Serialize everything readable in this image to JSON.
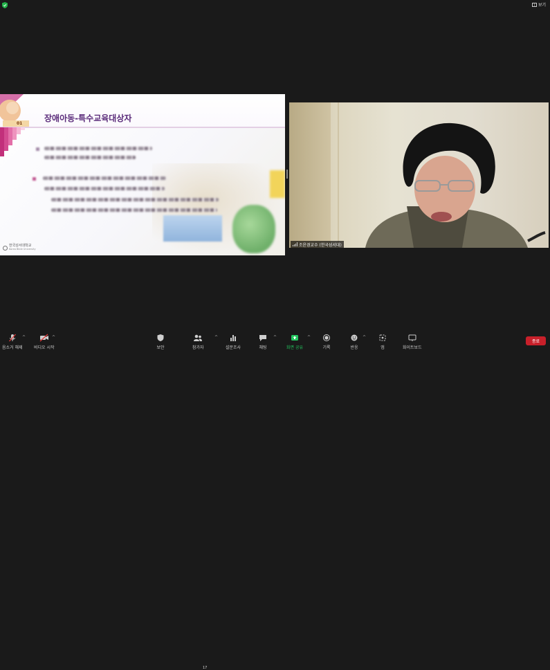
{
  "topbar": {
    "view_label": "보기"
  },
  "slide": {
    "title": "장애아동-특수교육대상자",
    "corner_label": "01",
    "logo_text": "한국성서대학교",
    "logo_sub": "Korea Bible University"
  },
  "video": {
    "participant_name": "조윤경교수 (한국성서대)"
  },
  "toolbar": {
    "audio_label": "음소거 해제",
    "video_label": "비디오 시작",
    "security_label": "보안",
    "participants_label": "참가자",
    "participants_count": "17",
    "polls_label": "설문조사",
    "chat_label": "채팅",
    "share_label": "화면 공유",
    "record_label": "기록",
    "reactions_label": "반응",
    "apps_label": "앱",
    "whiteboard_label": "화이트보드",
    "end_label": "종료"
  },
  "colors": {
    "share_green": "#22c55e",
    "end_red": "#c8202a",
    "slide_title": "#5a2b7a"
  }
}
